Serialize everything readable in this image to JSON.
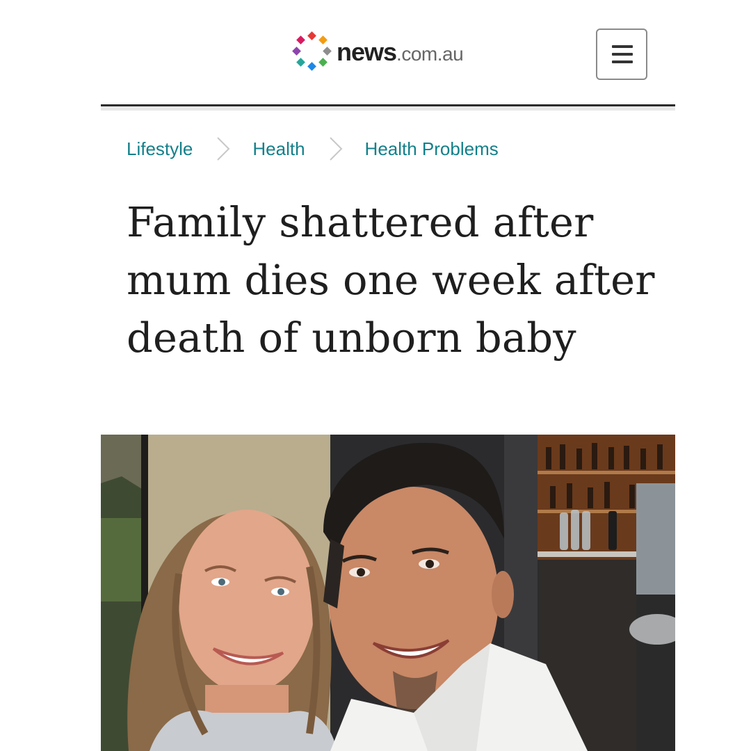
{
  "header": {
    "logo": {
      "bold": "news",
      "light": ".com.au",
      "icon": "news-logo-mark-icon"
    },
    "menu_button": {
      "icon": "hamburger-menu-icon"
    }
  },
  "breadcrumb": {
    "items": [
      {
        "label": "Lifestyle"
      },
      {
        "label": "Health"
      },
      {
        "label": "Health Problems"
      }
    ],
    "separator_icon": "chevron-right-icon"
  },
  "article": {
    "headline": "Family shattered after mum dies one week after death of unborn baby",
    "hero_image": "photo-couple-selfie"
  },
  "colors": {
    "breadcrumb_link": "#13808a",
    "headline_text": "#1f1f1f",
    "divider": "#2b2b2b"
  }
}
